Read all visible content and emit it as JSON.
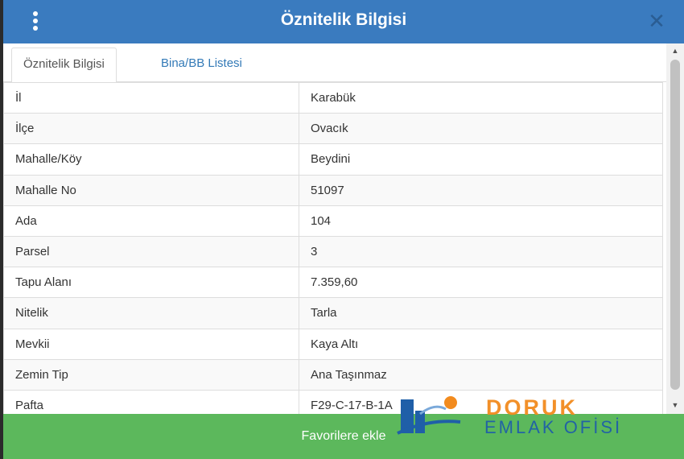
{
  "dialog": {
    "title": "Öznitelik Bilgisi"
  },
  "tabs": [
    {
      "label": "Öznitelik Bilgisi",
      "active": true
    },
    {
      "label": "Bina/BB Listesi",
      "active": false
    }
  ],
  "attributes": [
    {
      "label": "İl",
      "value": "Karabük"
    },
    {
      "label": "İlçe",
      "value": "Ovacık"
    },
    {
      "label": "Mahalle/Köy",
      "value": "Beydini"
    },
    {
      "label": "Mahalle No",
      "value": "51097"
    },
    {
      "label": "Ada",
      "value": "104"
    },
    {
      "label": "Parsel",
      "value": "3"
    },
    {
      "label": "Tapu Alanı",
      "value": "7.359,60"
    },
    {
      "label": "Nitelik",
      "value": "Tarla"
    },
    {
      "label": "Mevkii",
      "value": "Kaya Altı"
    },
    {
      "label": "Zemin Tip",
      "value": "Ana Taşınmaz"
    },
    {
      "label": "Pafta",
      "value": "F29-C-17-B-1A"
    }
  ],
  "footer": {
    "favorite_label": "Favorilere ekle"
  },
  "watermark": {
    "line1": "DORUK",
    "line2": "EMLAK OFİSİ"
  },
  "colors": {
    "header": "#3a7bbf",
    "footer": "#5cb85c",
    "tab_link": "#337ab7",
    "logo_orange": "#f28b1e",
    "logo_blue": "#1f5fa8"
  },
  "icons": {
    "menu": "vertical-ellipsis-icon",
    "close": "close-icon",
    "scroll_up": "triangle-up-icon",
    "scroll_down": "triangle-down-icon"
  }
}
